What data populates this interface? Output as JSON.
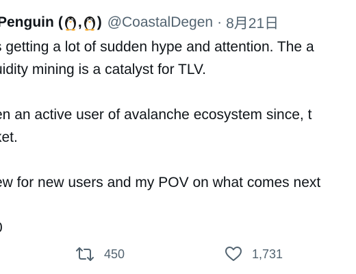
{
  "tweet": {
    "display_name": "Penguin",
    "emoji_open": "(",
    "emoji_comma": ",",
    "emoji_close": ")",
    "handle": "@CoastalDegen",
    "separator": "·",
    "date": "8月21日",
    "lines": [
      "s getting a lot of sudden hype and attention. The a",
      "uidity mining is a catalyst for TLV.",
      "",
      "en an active user of avalanche ecosystem since, t",
      "ket.",
      "",
      "ew for new users and my POV on what comes next",
      "",
      "0"
    ]
  },
  "actions": {
    "retweet": {
      "icon": "retweet-icon",
      "count": "450"
    },
    "like": {
      "icon": "heart-icon",
      "count": "1,731"
    }
  }
}
